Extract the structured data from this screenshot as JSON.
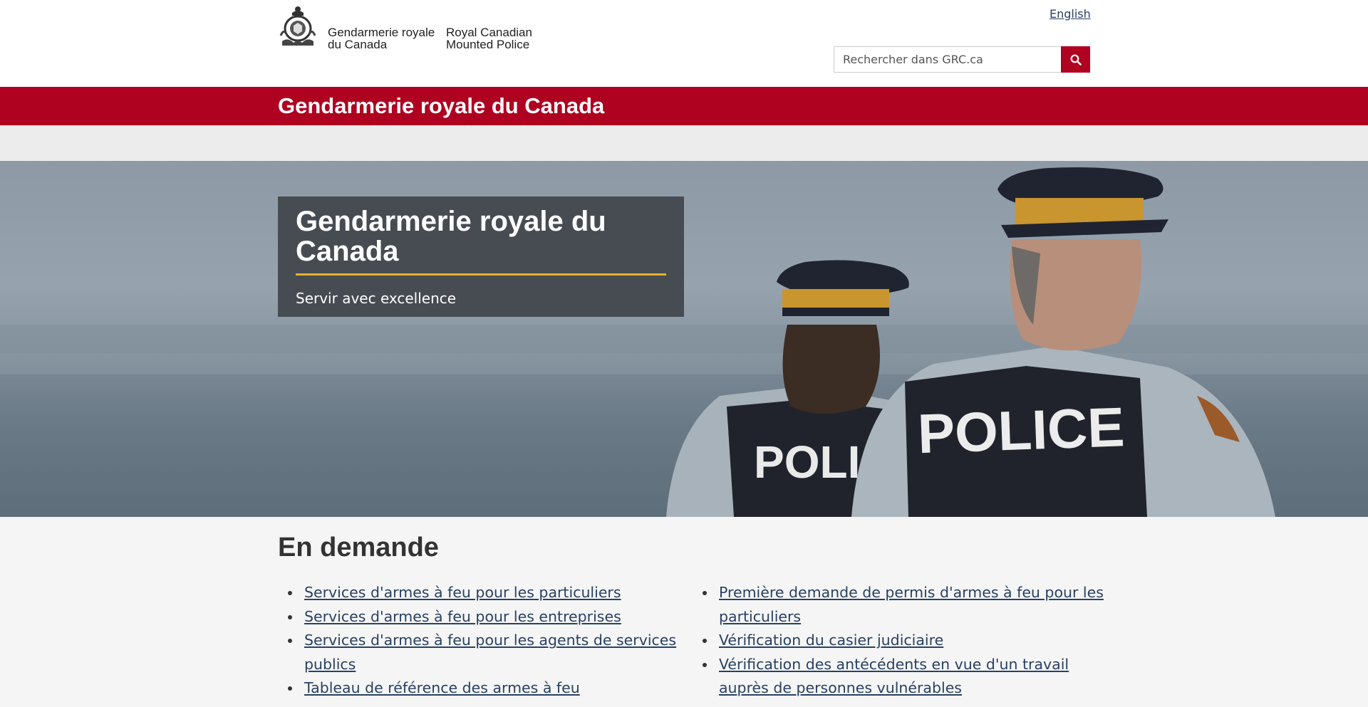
{
  "header": {
    "signature_fr": "Gendarmerie royale du Canada",
    "signature_en": "Royal Canadian Mounted Police",
    "language_link": "English",
    "search_placeholder": "Rechercher dans GRC.ca",
    "search_icon": "search-icon"
  },
  "banner": {
    "title": "Gendarmerie royale du Canada"
  },
  "hero": {
    "title": "Gendarmerie royale du Canada",
    "subtitle": "Servir avec excellence",
    "vest_label": "POLICE",
    "accent_color": "#e6b233"
  },
  "main": {
    "title": "En demande",
    "left_links": [
      "Services d'armes à feu pour les particuliers",
      "Services d'armes à feu pour les entreprises",
      "Services d'armes à feu pour les agents de services publics",
      "Tableau de référence des armes à feu"
    ],
    "right_links": [
      "Première demande de permis d'armes à feu pour les particuliers",
      "Vérification du casier judiciaire",
      "Vérification des antécédents en vue d'un travail auprès de personnes vulnérables"
    ]
  },
  "colors": {
    "brand_red": "#af0120",
    "link": "#284162",
    "hero_box": "#3c4046"
  }
}
